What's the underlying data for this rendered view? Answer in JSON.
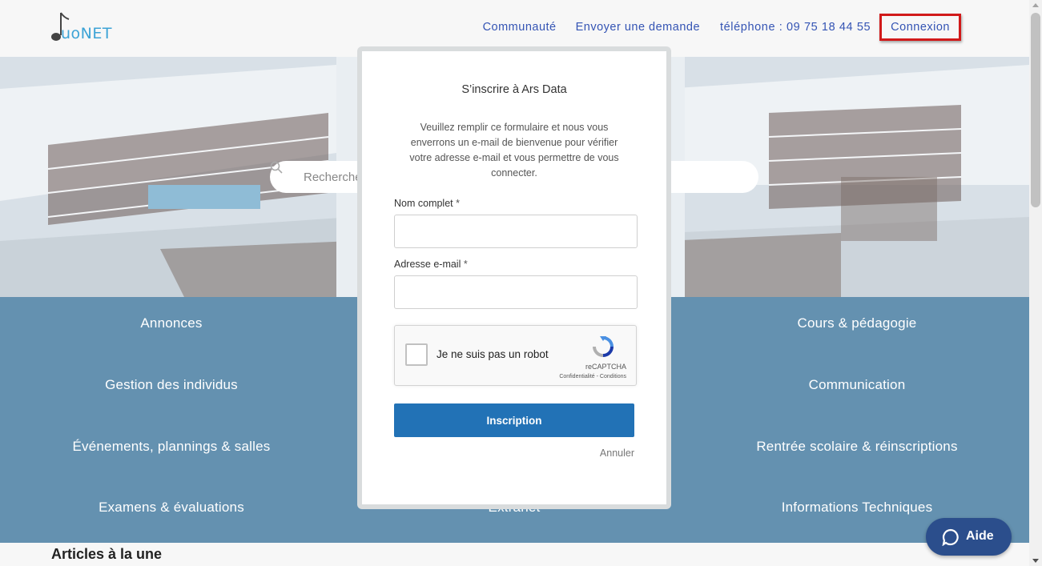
{
  "header": {
    "logo_text": "uoNET",
    "nav": {
      "community": "Communauté",
      "request": "Envoyer une demande",
      "phone": "téléphone : 09 75 18 44 55",
      "login": "Connexion"
    }
  },
  "search": {
    "placeholder": "Recherche"
  },
  "categories": [
    "Annonces",
    "Cours & pédagogie",
    "Gestion des individus",
    "Communication",
    "Événements, plannings & salles",
    "Rentrée scolaire & réinscriptions",
    "Examens & évaluations",
    "Extranet",
    "Informations Techniques"
  ],
  "articles": {
    "title": "Articles à la une"
  },
  "modal": {
    "title": "S’inscrire à Ars Data",
    "description": "Veuillez remplir ce formulaire et nous vous enverrons un e-mail de bienvenue pour vérifier votre adresse e-mail et vous permettre de vous connecter.",
    "name_label": "Nom complet",
    "email_label": "Adresse e-mail",
    "required_mark": "*",
    "name_value": "",
    "email_value": "",
    "captcha": {
      "label": "Je ne suis pas un robot",
      "brand": "reCAPTCHA",
      "links": "Confidentialité - Conditions"
    },
    "submit_label": "Inscription",
    "cancel_label": "Annuler"
  },
  "help": {
    "label": "Aide"
  },
  "colors": {
    "nav_link": "#3454b4",
    "highlight_border": "#d11a1a",
    "category_bg": "#6491b0",
    "submit_bg": "#2272b6",
    "help_bg": "#2b4e8c"
  }
}
